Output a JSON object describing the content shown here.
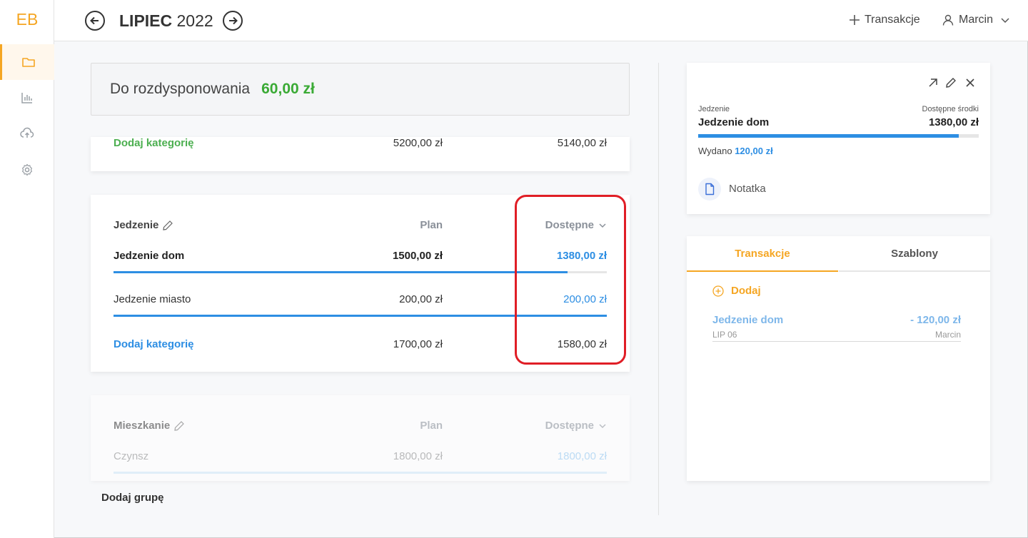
{
  "app": {
    "logo": "EB"
  },
  "sidebar": {
    "items": [
      {
        "icon": "folder-icon",
        "active": true
      },
      {
        "icon": "chart-icon",
        "active": false
      },
      {
        "icon": "cloud-upload-icon",
        "active": false
      },
      {
        "icon": "gear-icon",
        "active": false
      }
    ]
  },
  "header": {
    "month_bold": "LIPIEC",
    "year": " 2022",
    "add_transaction": "Transakcje",
    "user": "Marcin"
  },
  "summary": {
    "label": "Do rozdysponowania",
    "value": "60,00 zł"
  },
  "group_top": {
    "add_category": "Dodaj kategorię",
    "plan_total": "5200,00 zł",
    "available_total": "5140,00 zł"
  },
  "group_food": {
    "title": "Jedzenie",
    "col_plan": "Plan",
    "col_available": "Dostępne",
    "rows": [
      {
        "name": "Jedzenie dom",
        "plan": "1500,00 zł",
        "available": "1380,00 zł",
        "progress": 0.92
      },
      {
        "name": "Jedzenie miasto",
        "plan": "200,00 zł",
        "available": "200,00 zł",
        "progress": 1.0
      }
    ],
    "add_category": "Dodaj kategorię",
    "plan_total": "1700,00 zł",
    "available_total": "1580,00 zł"
  },
  "group_housing": {
    "title": "Mieszkanie",
    "col_plan": "Plan",
    "col_available": "Dostępne",
    "rows": [
      {
        "name": "Czynsz",
        "plan": "1800,00 zł",
        "available": "1800,00 zł",
        "progress": 1.0
      }
    ]
  },
  "add_group": "Dodaj grupę",
  "detail": {
    "group_label": "Jedzenie",
    "category": "Jedzenie dom",
    "funds_label": "Dostępne środki",
    "funds_value": "1380,00 zł",
    "progress": 0.93,
    "spent_label": "Wydano",
    "spent_value": "120,00 zł",
    "note_label": "Notatka"
  },
  "tabs": {
    "transactions": "Transakcje",
    "templates": "Szablony",
    "add": "Dodaj",
    "transaction": {
      "name": "Jedzenie dom",
      "amount": "- 120,00 zł",
      "date": "LIP 06",
      "user": "Marcin"
    }
  },
  "colors": {
    "accent": "#f5a623",
    "green": "#4caf50",
    "blue": "#2d8ee3",
    "highlight": "#e01e26"
  }
}
